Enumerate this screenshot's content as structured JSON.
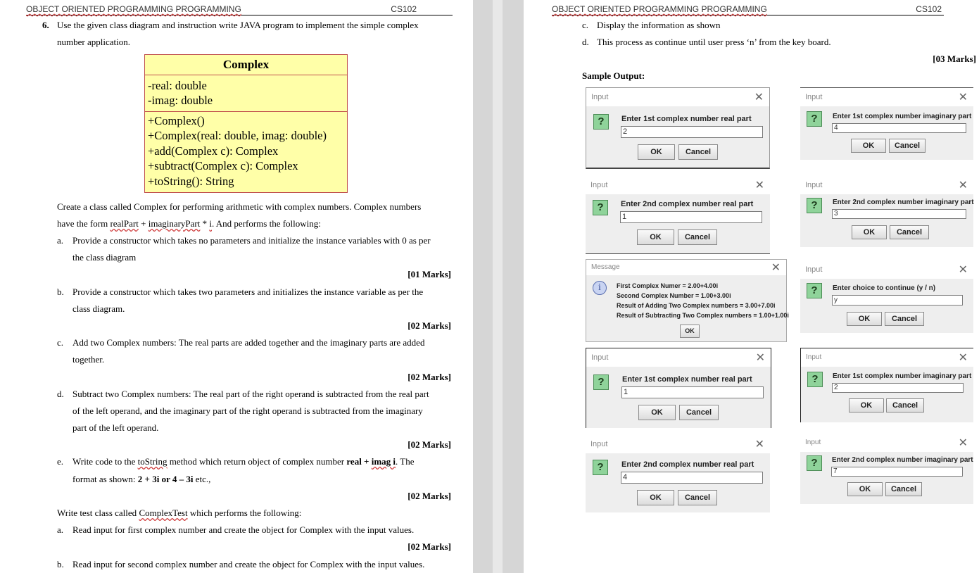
{
  "header": {
    "course_title": "OBJECT ORIENTED PROGRAMMING PROGRAMMING",
    "course_code": "CS102"
  },
  "left": {
    "q_number": "6.",
    "q_text_1": "Use the given class diagram and instruction write JAVA program to implement the simple complex",
    "q_text_2": "number application.",
    "uml": {
      "class_name": "Complex",
      "fields": [
        "-real: double",
        "-imag: double"
      ],
      "methods": [
        "+Complex()",
        "+Complex(real: double, imag: double)",
        "+add(Complex c): Complex",
        "+subtract(Complex c): Complex",
        "+toString(): String"
      ]
    },
    "para1_line1": "Create a class called Complex for performing arithmetic with complex numbers. Complex numbers",
    "para1_line2_a": "have the form ",
    "para1_line2_b": "realPart",
    "para1_line2_c": " + ",
    "para1_line2_d": "imaginaryPart",
    "para1_line2_e": " * ",
    "para1_line2_f": "i",
    "para1_line2_g": ". And performs the following:",
    "a_letter": "a.",
    "a_line1": "Provide a constructor which takes no parameters and initialize the instance variables with 0 as per",
    "a_line2": "the class diagram",
    "a_marks": "[01 Marks]",
    "b_letter": "b.",
    "b_line1": "Provide a constructor which takes two parameters and initializes the instance variable as per the",
    "b_line2": "class diagram.",
    "b_marks": "[02 Marks]",
    "c_letter": "c.",
    "c_line1": "Add two Complex numbers: The real parts are added together and the imaginary parts are added",
    "c_line2": "together.",
    "c_marks": "[02 Marks]",
    "d_letter": "d.",
    "d_line1": "Subtract two Complex numbers: The real part of the right operand is subtracted from the real part",
    "d_line2": "of the left operand, and the imaginary part of the right operand is subtracted from the imaginary",
    "d_line3": "part of the left operand.",
    "d_marks": "[02 Marks]",
    "e_letter": "e.",
    "e_line1_a": "Write code to the ",
    "e_line1_b": "toString",
    "e_line1_c": " method which return object of complex number ",
    "e_line1_d": "real + ",
    "e_line1_e": "imag i",
    "e_line1_f": ". The",
    "e_line2_a": "format as shown: ",
    "e_line2_b": "2 + 3i or 4 – 3i",
    "e_line2_c": " etc.,",
    "e_marks": "[02 Marks]",
    "test_a": "Write test class called ",
    "test_b": "ComplexTest",
    "test_c": " which performs the following:",
    "ta_letter": "a.",
    "ta_line": "Read input for first complex number and create the object for Complex with the input values.",
    "ta_marks": "[02 Marks]",
    "tb_letter": "b.",
    "tb_line": "Read input for second complex number and create the object for Complex with the input values."
  },
  "right": {
    "c_letter": "c.",
    "c_line": "Display the information as shown",
    "d_letter": "d.",
    "d_line": "This process as continue until user press ‘n’ from the key board.",
    "marks": "[03 Marks]",
    "sample_output": "Sample Output:",
    "dialogs": [
      {
        "title": "Input",
        "prompt": "Enter 1st complex number real part",
        "value": "2",
        "ok": "OK",
        "cancel": "Cancel"
      },
      {
        "title": "Input",
        "prompt": "Enter 1st complex number imaginary part",
        "value": "4",
        "ok": "OK",
        "cancel": "Cancel"
      },
      {
        "title": "Input",
        "prompt": "Enter 2nd complex number real part",
        "value": "1",
        "ok": "OK",
        "cancel": "Cancel"
      },
      {
        "title": "Input",
        "prompt": "Enter 2nd complex number imaginary part",
        "value": "3",
        "ok": "OK",
        "cancel": "Cancel"
      },
      {
        "title": "Input",
        "prompt": "Enter choice to continue (y / n)",
        "value": "y",
        "ok": "OK",
        "cancel": "Cancel"
      },
      {
        "title": "Input",
        "prompt": "Enter 1st complex number real part",
        "value": "1",
        "ok": "OK",
        "cancel": "Cancel"
      },
      {
        "title": "Input",
        "prompt": "Enter 1st complex number imaginary part",
        "value": "2",
        "ok": "OK",
        "cancel": "Cancel"
      },
      {
        "title": "Input",
        "prompt": "Enter 2nd complex number real part",
        "value": "4",
        "ok": "OK",
        "cancel": "Cancel"
      },
      {
        "title": "Input",
        "prompt": "Enter 2nd complex number imaginary part",
        "value": "7",
        "ok": "OK",
        "cancel": "Cancel"
      }
    ],
    "message": {
      "title": "Message",
      "lines": [
        "First Complex Numer = 2.00+4.00i",
        "Second Complex Number = 1.00+3.00i",
        "Result of Adding Two Complex numbers = 3.00+7.00i",
        "Result of Subtracting Two Complex numbers = 1.00+1.00i"
      ],
      "ok": "OK"
    },
    "icons": {
      "question": "question-icon",
      "info": "info-icon",
      "close": "close-icon"
    },
    "glyphs": {
      "question": "?",
      "info": "i",
      "close": "✕"
    }
  }
}
